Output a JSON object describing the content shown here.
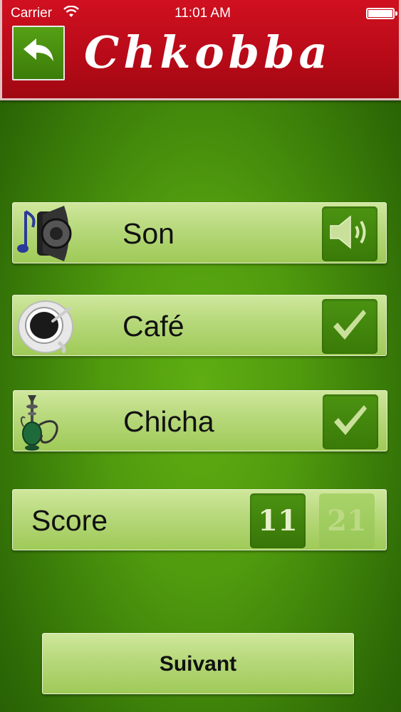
{
  "status_bar": {
    "carrier": "Carrier",
    "time": "11:01 AM"
  },
  "header": {
    "logo_text": "Chkobba",
    "back_icon": "back-arrow-icon"
  },
  "settings": {
    "sound": {
      "label": "Son",
      "icon": "speaker-music-icon",
      "toggle_icon": "speaker-on-icon"
    },
    "coffee": {
      "label": "Café",
      "icon": "coffee-cup-icon",
      "toggle_icon": "checkmark-icon",
      "checked": true
    },
    "shisha": {
      "label": "Chicha",
      "icon": "hookah-icon",
      "toggle_icon": "checkmark-icon",
      "checked": true
    },
    "score": {
      "label": "Score",
      "options": [
        "11",
        "21"
      ],
      "selected": "11"
    }
  },
  "next_button": {
    "label": "Suivant"
  },
  "colors": {
    "header_red": "#c00d1c",
    "felt_green": "#4f9a0e",
    "toggle_green": "#3f820b",
    "row_light": "#b6d87a"
  }
}
